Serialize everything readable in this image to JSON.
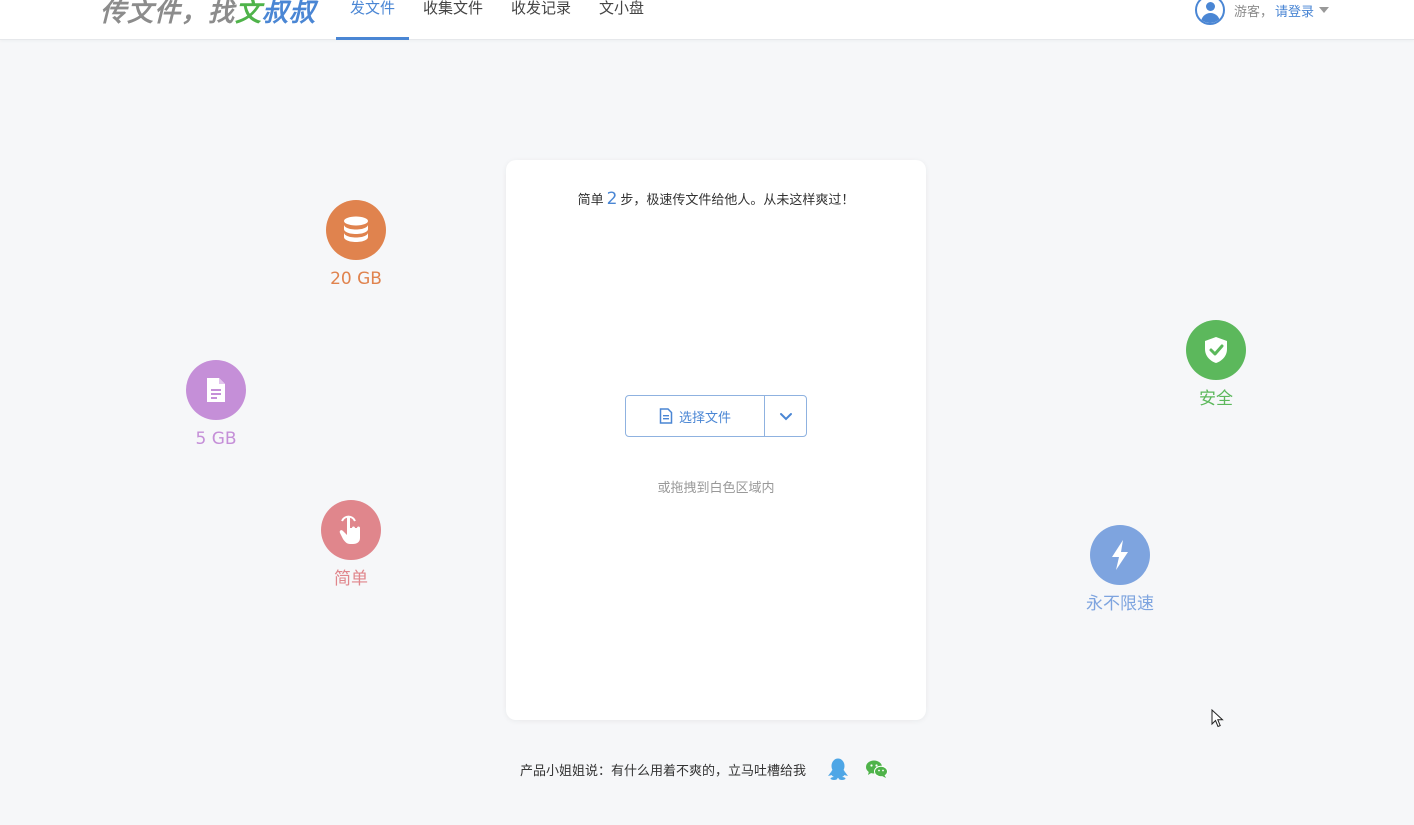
{
  "header": {
    "logo_prefix": "传文件，找",
    "logo_green": "文",
    "logo_blue": "叔叔",
    "nav": [
      {
        "label": "发文件",
        "active": true
      },
      {
        "label": "收集文件",
        "active": false
      },
      {
        "label": "收发记录",
        "active": false
      },
      {
        "label": "文小盘",
        "active": false
      }
    ],
    "user": {
      "guest_label": "游客，",
      "login_label": "请登录",
      "avatar_icon": "user-avatar-icon",
      "caret_icon": "caret-down-icon"
    }
  },
  "features": {
    "storage": {
      "label": "20 GB",
      "color": "#e0834e",
      "icon": "database-icon"
    },
    "file_size": {
      "label": "5 GB",
      "color": "#c58fd8",
      "icon": "document-icon"
    },
    "simple": {
      "label": "简单",
      "color": "#e0868c",
      "icon": "hand-pointer-icon"
    },
    "secure": {
      "label": "安全",
      "color": "#5cb85c",
      "icon": "shield-check-icon"
    },
    "speed": {
      "label": "永不限速",
      "color": "#7ea4df",
      "icon": "lightning-icon"
    }
  },
  "upload": {
    "title_prefix": "简单",
    "title_step": "2",
    "title_suffix": "步，极速传文件给他人。从未这样爽过！",
    "select_label": "选择文件",
    "select_icon": "file-icon",
    "dropdown_icon": "chevron-down-icon",
    "drag_hint": "或拖拽到白色区域内"
  },
  "footer": {
    "feedback_text": "产品小姐姐说：有什么用着不爽的，立马吐槽给我",
    "qq_icon": "qq-penguin-icon",
    "wechat_icon": "wechat-icon",
    "qq_color": "#4ea6e6",
    "wechat_color": "#4fb34a"
  },
  "colors": {
    "accent": "#4a86d4",
    "background": "#f6f7f9"
  }
}
